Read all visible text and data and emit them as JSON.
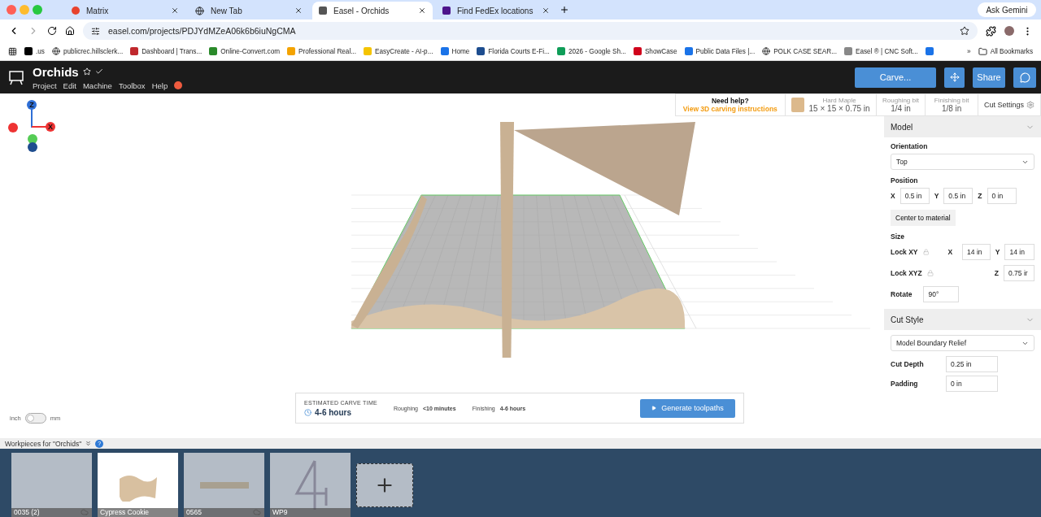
{
  "browser": {
    "tabs": [
      {
        "title": "Matrix",
        "selected": false
      },
      {
        "title": "New Tab",
        "selected": false
      },
      {
        "title": "Easel - Orchids",
        "selected": true
      },
      {
        "title": "Find FedEx locations",
        "selected": false
      }
    ],
    "gemini": "Ask Gemini",
    "url": "easel.com/projects/PDJYdMZeA06k6b6iuNgCMA",
    "bookmarks": [
      {
        "label": ".us"
      },
      {
        "label": "publicrec.hillsclerk..."
      },
      {
        "label": "Dashboard | Trans..."
      },
      {
        "label": "Online-Convert.com"
      },
      {
        "label": "Professional Real..."
      },
      {
        "label": "EasyCreate - AI-p..."
      },
      {
        "label": "Home"
      },
      {
        "label": "Florida Courts E-Fi..."
      },
      {
        "label": "2026 - Google Sh..."
      },
      {
        "label": "ShowCase"
      },
      {
        "label": "Public Data Files |..."
      },
      {
        "label": "POLK CASE SEAR..."
      },
      {
        "label": "Easel ® | CNC Soft..."
      }
    ],
    "more": "»",
    "all_bookmarks": "All Bookmarks"
  },
  "app": {
    "title": "Orchids",
    "menu": [
      "Project",
      "Edit",
      "Machine",
      "Toolbox",
      "Help"
    ],
    "carve": "Carve...",
    "share": "Share"
  },
  "info": {
    "help_title": "Need help?",
    "help_link": "View 3D carving instructions",
    "material_name": "Hard Maple",
    "material_size": "15 × 15 × 0.75 in",
    "roughing_label": "Roughing bit",
    "roughing_value": "1/4 in",
    "finishing_label": "Finishing bit",
    "finishing_value": "1/8 in",
    "cut_settings": "Cut Settings"
  },
  "axes": {
    "z": "Z",
    "x": "X"
  },
  "units": {
    "left": "inch",
    "right": "mm",
    "on": false
  },
  "carve_time": {
    "label": "ESTIMATED CARVE TIME",
    "value": "4-6 hours",
    "roughing_label": "Roughing",
    "roughing_value": "<10 minutes",
    "finishing_label": "Finishing",
    "finishing_value": "4-6 hours",
    "button": "Generate toolpaths"
  },
  "model_panel": {
    "title": "Model",
    "orientation_label": "Orientation",
    "orientation": "Top",
    "position_label": "Position",
    "position": [
      {
        "axis": "X",
        "value": "0.5 in"
      },
      {
        "axis": "Y",
        "value": "0.5 in"
      },
      {
        "axis": "Z",
        "value": "0 in"
      }
    ],
    "center_button": "Center to material",
    "size_label": "Size",
    "lock_xy": "Lock XY",
    "size_x_axis": "X",
    "size_x": "14 in",
    "size_y_axis": "Y",
    "size_y": "14 in",
    "lock_xyz": "Lock XYZ",
    "size_z_axis": "Z",
    "size_z": "0.75 ir",
    "rotate_label": "Rotate",
    "rotate": "90°"
  },
  "cut_style": {
    "title": "Cut Style",
    "style": "Model Boundary Relief",
    "depth_label": "Cut Depth",
    "depth": "0.25 in",
    "padding_label": "Padding",
    "padding": "0 in"
  },
  "workpieces": {
    "title": "Workpieces for \"Orchids\"",
    "help": "?",
    "items": [
      {
        "name": "0035 (2)",
        "cloud": true,
        "selected": false
      },
      {
        "name": "Cypress Cookie",
        "cloud": false,
        "selected": true
      },
      {
        "name": "0565",
        "cloud": true,
        "selected": false
      },
      {
        "name": "WP9",
        "cloud": false,
        "selected": false
      }
    ]
  }
}
